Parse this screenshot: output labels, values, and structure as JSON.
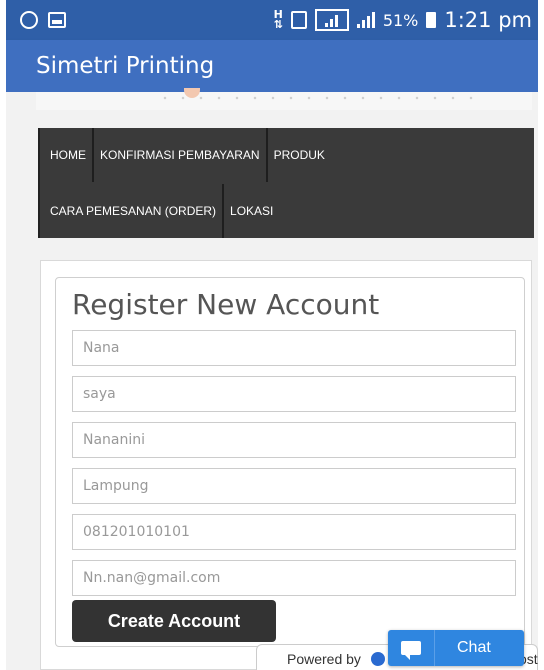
{
  "status_bar": {
    "battery_text": "51%",
    "time": "1:21 pm",
    "icons": [
      "whatsapp-icon",
      "image-icon",
      "h-network-icon",
      "sim-icon",
      "signal-icon",
      "signal-icon-2",
      "battery-icon"
    ]
  },
  "app_bar": {
    "title": "Simetri Printing"
  },
  "nav": {
    "row1": [
      "HOME",
      "KONFIRMASI PEMBAYARAN",
      "PRODUK"
    ],
    "row2": [
      "CARA PEMESANAN (ORDER)",
      "LOKASI"
    ]
  },
  "form": {
    "title": "Register New Account",
    "fields": [
      {
        "name": "first-name-field",
        "value": "Nana"
      },
      {
        "name": "last-name-field",
        "value": "saya"
      },
      {
        "name": "username-field",
        "value": "Nananini"
      },
      {
        "name": "city-field",
        "value": "Lampung"
      },
      {
        "name": "phone-field",
        "value": "081201010101"
      },
      {
        "name": "email-field",
        "value": "Nn.nan@gmail.com"
      }
    ],
    "submit_label": "Create Account"
  },
  "footer": {
    "powered_by": "Powered by",
    "powered_tail": "ost"
  },
  "chat": {
    "label": "Chat"
  },
  "colors": {
    "status_bar": "#2f5fa8",
    "app_bar": "#3f6fc0",
    "nav_bg": "#3a3a3a",
    "button": "#333333",
    "chat": "#2f86e0"
  }
}
